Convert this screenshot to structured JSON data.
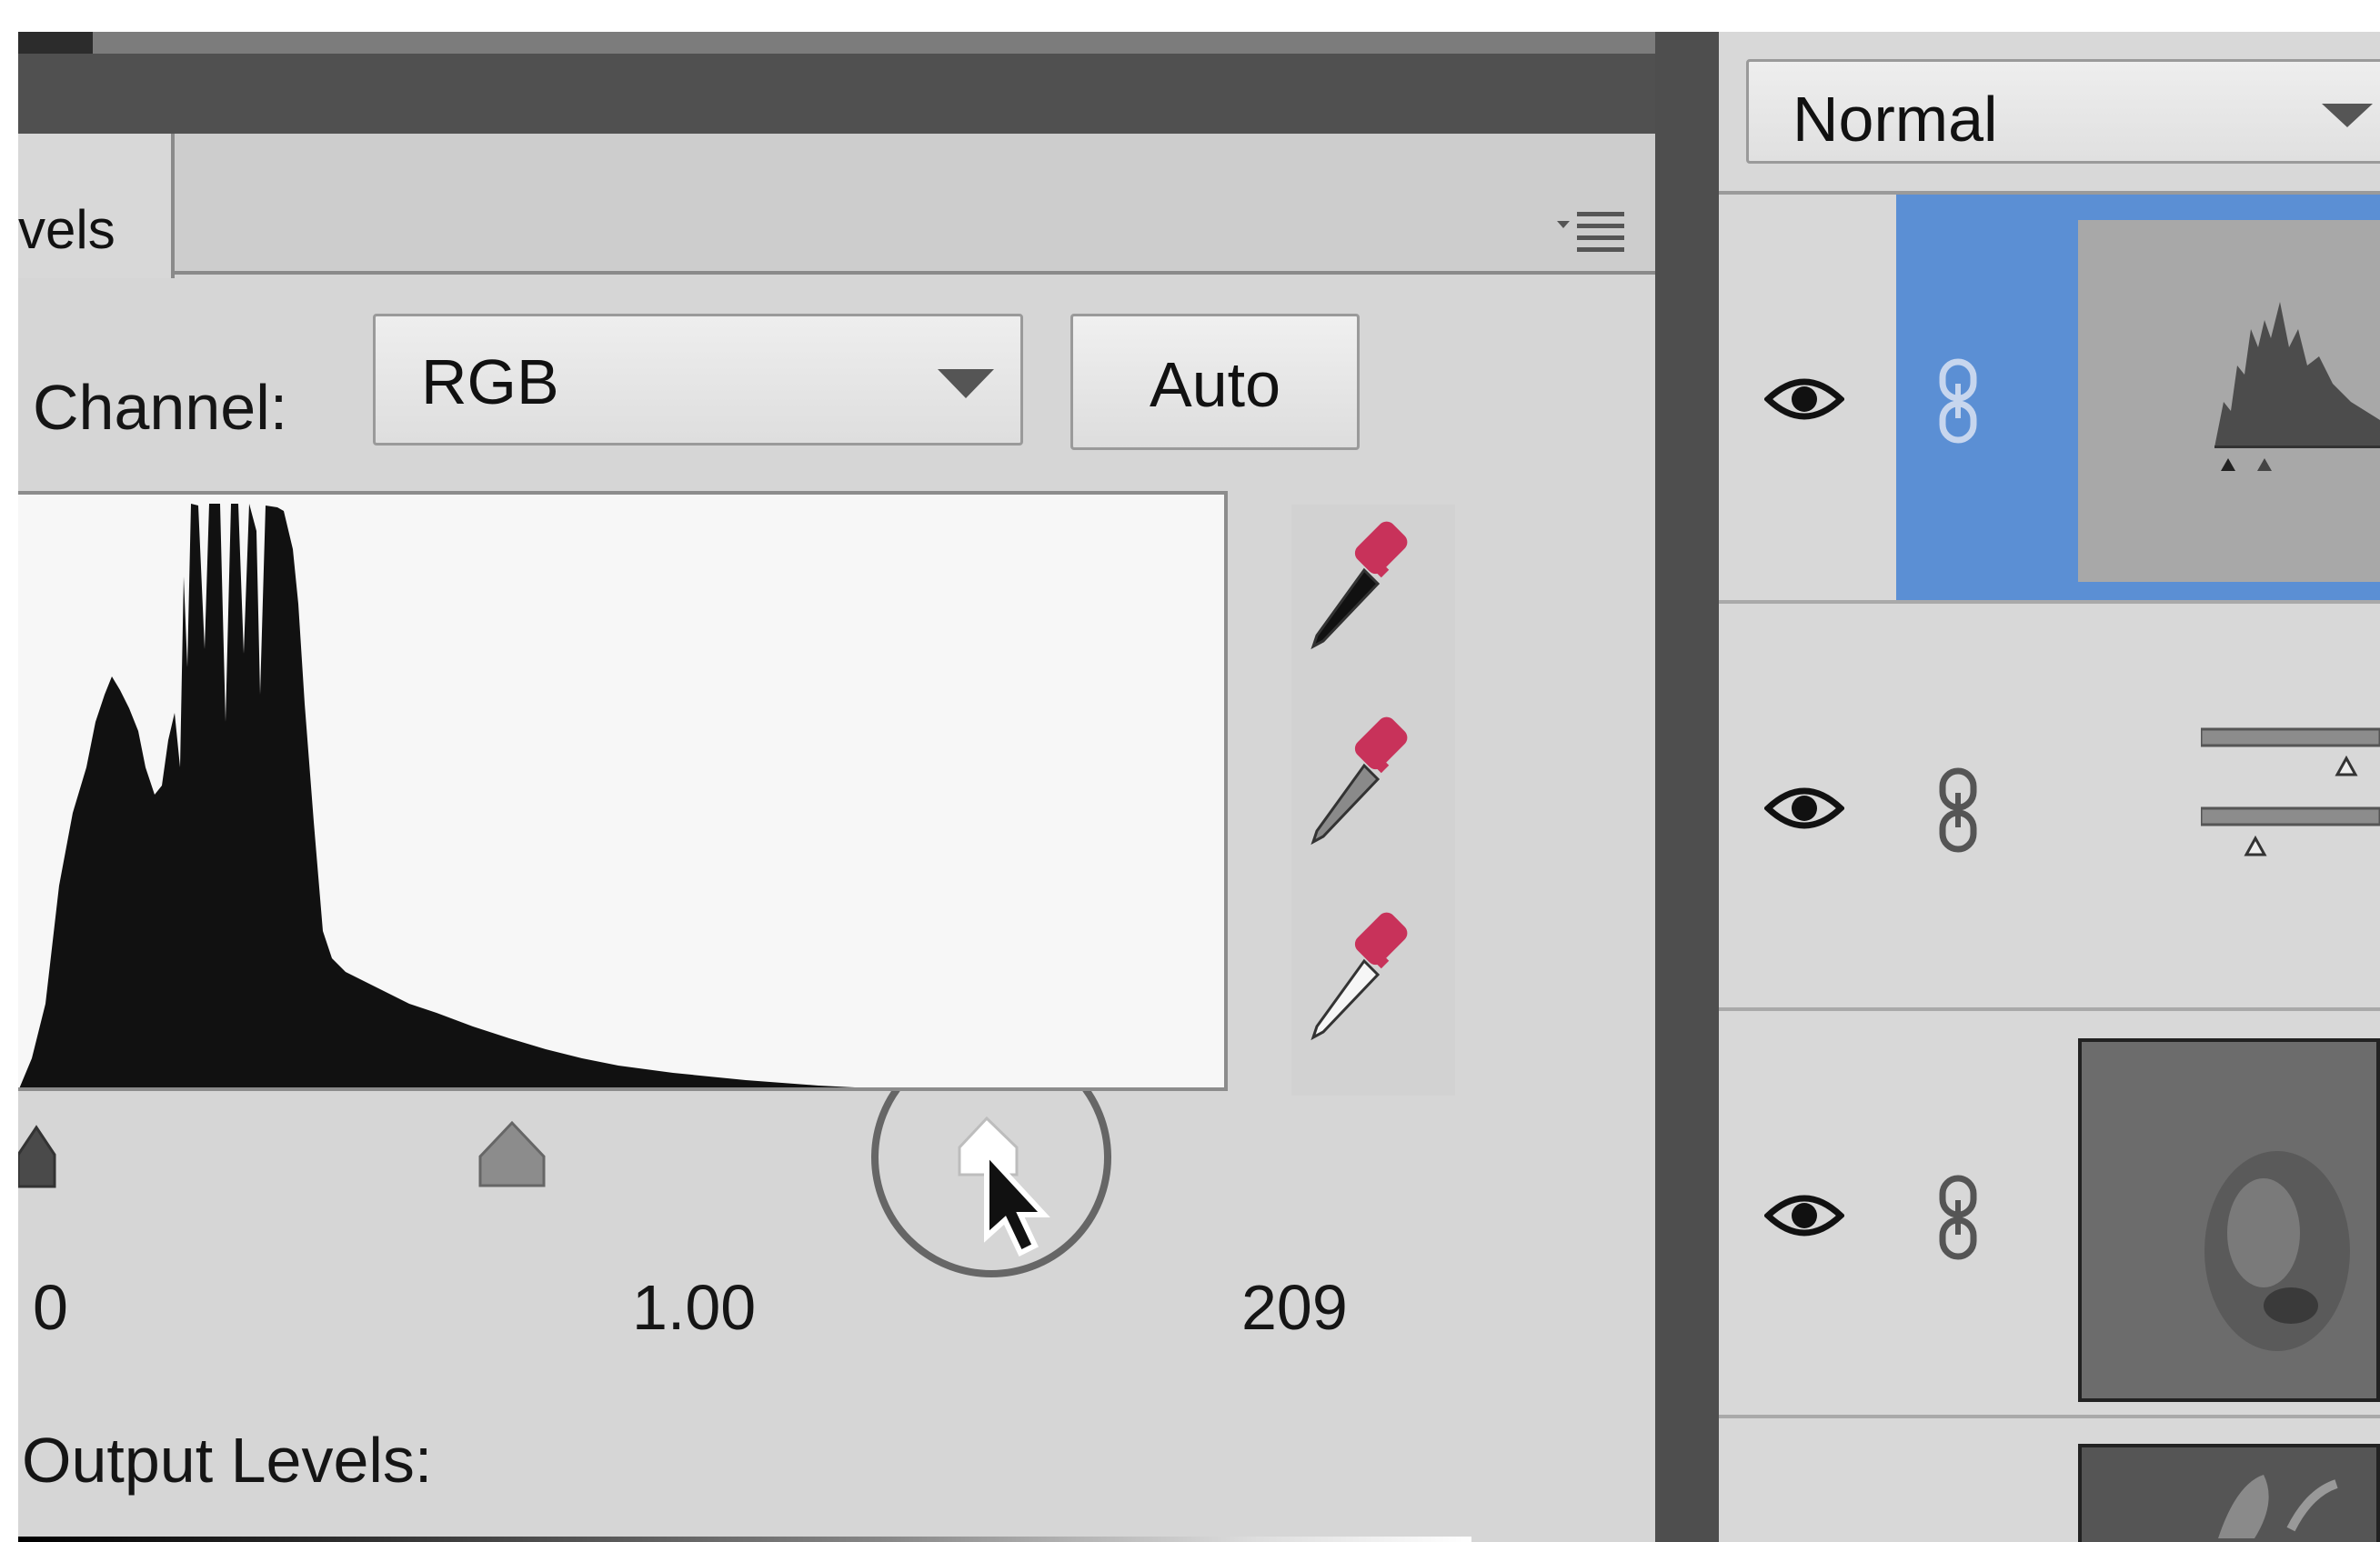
{
  "levels_panel": {
    "tab_label": "vels",
    "channel_label": "Channel:",
    "channel_value": "RGB",
    "auto_label": "Auto",
    "input_black": "0",
    "input_gamma": "1.00",
    "input_white": "209",
    "output_label": "Output Levels:",
    "icons": [
      "panel-menu-icon",
      "black-eyedropper-icon",
      "gray-eyedropper-icon",
      "white-eyedropper-icon",
      "cursor-icon"
    ]
  },
  "layers_panel": {
    "blend_mode": "Normal",
    "layers": [
      {
        "type": "levels-adjustment-histogram",
        "selected": true,
        "visible": true
      },
      {
        "type": "levels-adjustment",
        "selected": false,
        "visible": true
      },
      {
        "type": "image",
        "selected": false,
        "visible": true
      },
      {
        "type": "image",
        "selected": false,
        "visible": true
      }
    ]
  },
  "colors": {
    "selection": "#5b8fd4",
    "eyedropper_accent": "#c8325a"
  }
}
